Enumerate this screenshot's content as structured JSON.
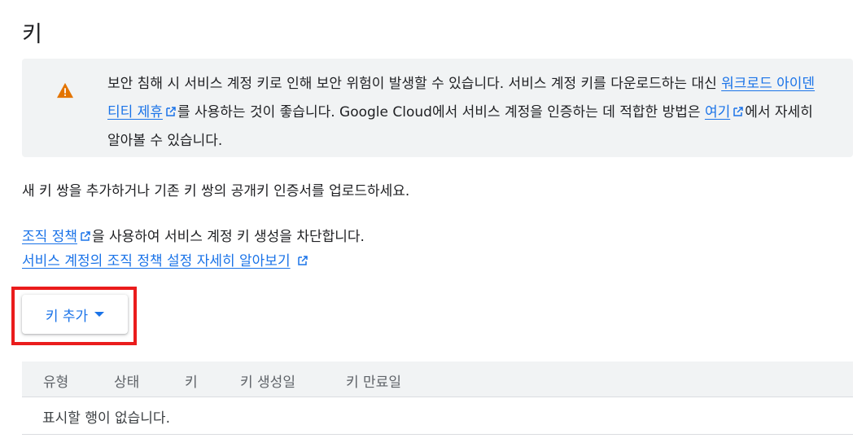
{
  "page": {
    "title": "키"
  },
  "warning": {
    "text1": "보안 침해 시 서비스 계정 키로 인해 보안 위험이 발생할 수 있습니다. 서비스 계정 키를 다운로드하는 대신 ",
    "link1": "워크로드 아이덴티티 제휴",
    "text2": "를 사용하는 것이 좋습니다. Google Cloud에서 서비스 계정을 인증하는 데 적합한 방법은 ",
    "link2": "여기",
    "text3": "에서 자세히 알아볼 수 있습니다."
  },
  "description": "새 키 쌍을 추가하거나 기존 키 쌍의 공개키 인증서를 업로드하세요.",
  "policy": {
    "link": "조직 정책",
    "text": "을 사용하여 서비스 계정 키 생성을 차단합니다.",
    "learn_more": "서비스 계정의 조직 정책 설정 자세히 알아보기"
  },
  "add_key_button": {
    "label": "키 추가"
  },
  "table": {
    "columns": [
      "유형",
      "상태",
      "키",
      "키 생성일",
      "키 만료일"
    ],
    "empty_message": "표시할 행이 없습니다."
  },
  "colors": {
    "link": "#1a73e8",
    "warning_icon": "#e37400",
    "highlight": "#ea1c1c"
  }
}
